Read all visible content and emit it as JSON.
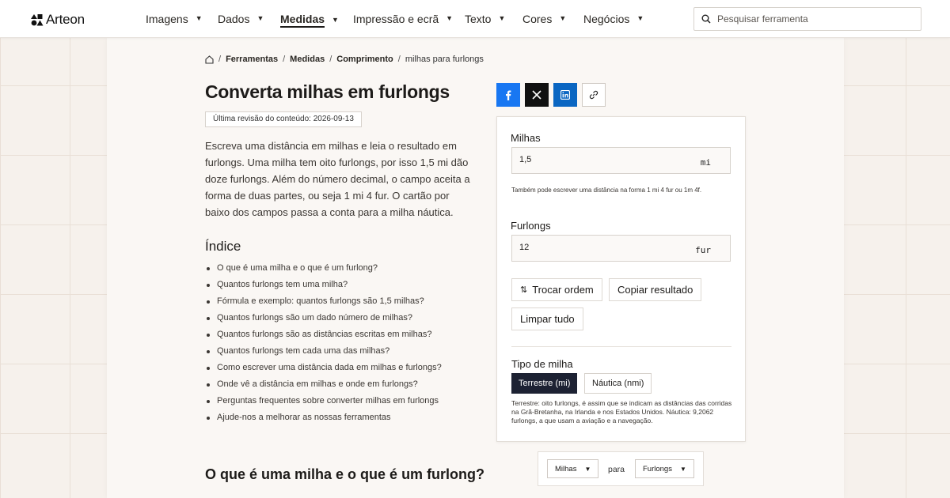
{
  "brand": {
    "name": "Arteon"
  },
  "nav": {
    "items": [
      {
        "label": "Imagens"
      },
      {
        "label": "Dados"
      },
      {
        "label": "Medidas"
      },
      {
        "label": "Impressão e ecrã"
      },
      {
        "label": "Texto"
      },
      {
        "label": "Cores"
      },
      {
        "label": "Negócios"
      }
    ],
    "active_index": 2,
    "caret": "▼"
  },
  "search": {
    "placeholder": "Pesquisar ferramenta"
  },
  "breadcrumb": {
    "items": [
      "Ferramentas",
      "Medidas",
      "Comprimento"
    ],
    "current": "milhas para furlongs",
    "separator": "/"
  },
  "page": {
    "title": "Converta milhas em furlongs",
    "revised": "Última revisão do conteúdo: 2026-09-13",
    "intro": "Escreva uma distância em milhas e leia o resultado em furlongs. Uma milha tem oito furlongs, por isso 1,5 mi dão doze furlongs. Além do número decimal, o campo aceita a forma de duas partes, ou seja 1 mi 4 fur. O cartão por baixo dos campos passa a conta para a milha náutica."
  },
  "toc": {
    "title": "Índice",
    "items": [
      "O que é uma milha e o que é um furlong?",
      "Quantos furlongs tem uma milha?",
      "Fórmula e exemplo: quantos furlongs são 1,5 milhas?",
      "Quantos furlongs são um dado número de milhas?",
      "Quantos furlongs são as distâncias escritas em milhas?",
      "Quantos furlongs tem cada uma das milhas?",
      "Como escrever uma distância dada em milhas e furlongs?",
      "Onde vê a distância em milhas e onde em furlongs?",
      "Perguntas frequentes sobre converter milhas em furlongs",
      "Ajude-nos a melhorar as nossas ferramentas"
    ]
  },
  "converter": {
    "from": {
      "label": "Milhas",
      "value": "1,5",
      "unit": "mi"
    },
    "hint": "Também pode escrever uma distância na forma 1 mi 4 fur ou 1m 4f.",
    "to": {
      "label": "Furlongs",
      "value": "12",
      "unit": "fur"
    },
    "buttons": {
      "swap": "Trocar ordem",
      "copy": "Copiar resultado",
      "clear": "Limpar tudo"
    },
    "mile_type": {
      "label": "Tipo de milha",
      "options": [
        "Terrestre (mi)",
        "Náutica (nmi)"
      ],
      "selected": 0,
      "description": "Terrestre: oito furlongs, é assim que se indicam as distâncias das corridas na Grã-Bretanha, na Irlanda e nos Estados Unidos. Náutica: 9,2062 furlongs, a que usam a aviação e a navegação."
    }
  },
  "unit_selector": {
    "from": "Milhas",
    "word": "para",
    "to": "Furlongs"
  },
  "section": {
    "title": "O que é uma milha e o que é um furlong?"
  },
  "colors": {
    "facebook": "#1877f2",
    "x": "#111111",
    "linkedin": "#0a66c2",
    "selected_segment": "#1d2233"
  }
}
